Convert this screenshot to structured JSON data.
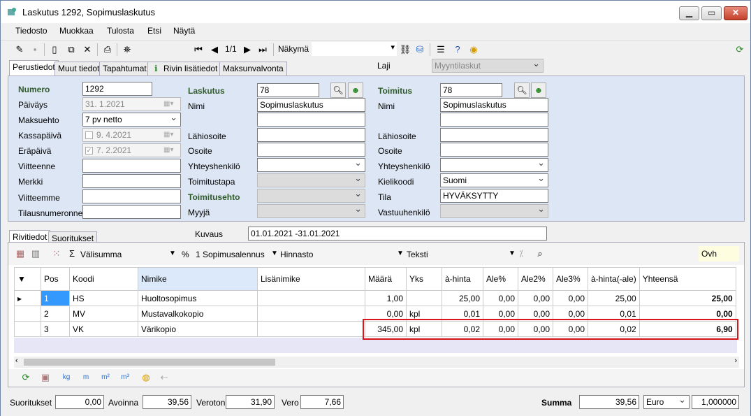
{
  "window": {
    "title": "Laskutus 1292, Sopimuslaskutus"
  },
  "menu": [
    "Tiedosto",
    "Muokkaa",
    "Tulosta",
    "Etsi",
    "Näytä"
  ],
  "toolbar": {
    "record_pos": "1/1",
    "view_label": "Näkymä"
  },
  "tabs_top": [
    "Perustiedot",
    "Muut tiedot",
    "Tapahtumat",
    "Rivin lisätiedot",
    "Maksunvalvonta"
  ],
  "laji": {
    "label": "Laji",
    "value": "Myyntilaskut"
  },
  "left": {
    "numero_label": "Numero",
    "numero": "1292",
    "paivays_label": "Päiväys",
    "paivays": "31. 1.2021",
    "maksuehto_label": "Maksuehto",
    "maksuehto": "7 pv netto",
    "kassapaiva_label": "Kassapäivä",
    "kassapaiva": "9. 4.2021",
    "erapaiva_label": "Eräpäivä",
    "erapaiva": "7. 2.2021",
    "viitteenne_label": "Viitteenne",
    "merkki_label": "Merkki",
    "viitteemme_label": "Viitteemme",
    "tilausnumeronne_label": "Tilausnumeronne"
  },
  "mid": {
    "laskutus_label": "Laskutus",
    "laskutus": "78",
    "nimi_label": "Nimi",
    "nimi": "Sopimuslaskutus",
    "lahiosoite_label": "Lähiosoite",
    "osoite_label": "Osoite",
    "yhteys_label": "Yhteyshenkilö",
    "toimitustapa_label": "Toimitustapa",
    "toimitusehto_label": "Toimitusehto",
    "myyja_label": "Myyjä"
  },
  "right": {
    "toimitus_label": "Toimitus",
    "toimitus": "78",
    "nimi_label": "Nimi",
    "nimi": "Sopimuslaskutus",
    "lahiosoite_label": "Lähiosoite",
    "osoite_label": "Osoite",
    "yhteys_label": "Yhteyshenkilö",
    "kielikoodi_label": "Kielikoodi",
    "kielikoodi": "Suomi",
    "tila_label": "Tila",
    "tila": "HYVÄKSYTTY",
    "vastuu_label": "Vastuuhenkilö"
  },
  "tabs_bottom": [
    "Rivitiedot",
    "Suoritukset"
  ],
  "kuvaus": {
    "label": "Kuvaus",
    "value": "01.01.2021 -31.01.2021"
  },
  "gridbar": {
    "valisumma": "Välisumma",
    "percent": "%",
    "alennus": "1 Sopimusalennus",
    "hinnasto": "Hinnasto",
    "teksti": "Teksti",
    "ovh": "Ovh"
  },
  "columns": [
    "Pos",
    "Koodi",
    "Nimike",
    "Lisänimike",
    "Määrä",
    "Yks",
    "à-hinta",
    "Ale%",
    "Ale2%",
    "Ale3%",
    "à-hinta(-ale)",
    "Yhteensä"
  ],
  "rows": [
    [
      "1",
      "HS",
      "Huoltosopimus",
      "",
      "1,00",
      "",
      "25,00",
      "0,00",
      "0,00",
      "0,00",
      "25,00",
      "25,00"
    ],
    [
      "2",
      "MV",
      "Mustavalkokopio",
      "",
      "0,00",
      "kpl",
      "0,01",
      "0,00",
      "0,00",
      "0,00",
      "0,01",
      "0,00"
    ],
    [
      "3",
      "VK",
      "Värikopio",
      "",
      "345,00",
      "kpl",
      "0,02",
      "0,00",
      "0,00",
      "0,00",
      "0,02",
      "6,90"
    ]
  ],
  "bottom": {
    "suoritukset_label": "Suoritukset",
    "suoritukset": "0,00",
    "avoinna_label": "Avoinna",
    "avoinna": "39,56",
    "veroton_label": "Veroton",
    "veroton": "31,90",
    "vero_label": "Vero",
    "vero": "7,66",
    "summa_label": "Summa",
    "summa": "39,56",
    "currency": "Euro",
    "rate": "1,000000"
  },
  "colors": {
    "panel": "#dde6f5",
    "highlight": "#d9161a",
    "select": "#3399ff"
  }
}
